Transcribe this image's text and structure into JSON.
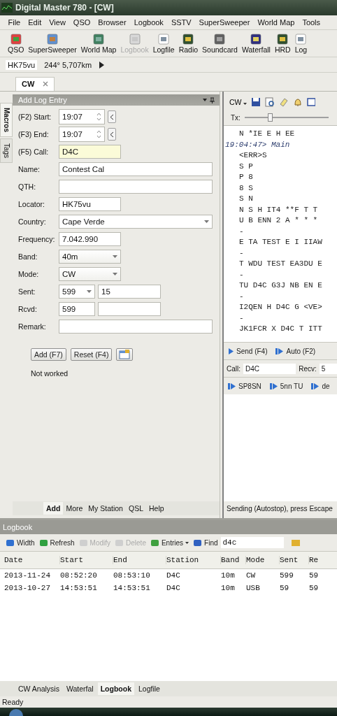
{
  "window": {
    "title": "Digital Master 780 - [CW]"
  },
  "menu": [
    "File",
    "Edit",
    "View",
    "QSO",
    "Browser",
    "Logbook",
    "SSTV",
    "SuperSweeper",
    "World Map",
    "Tools"
  ],
  "toolbar": [
    {
      "label": "QSO",
      "disabled": false
    },
    {
      "label": "SuperSweeper",
      "disabled": false
    },
    {
      "label": "World Map",
      "disabled": false
    },
    {
      "label": "Logbook",
      "disabled": true
    },
    {
      "label": "Logfile",
      "disabled": false
    },
    {
      "label": "Radio",
      "disabled": false
    },
    {
      "label": "Soundcard",
      "disabled": false
    },
    {
      "label": "Waterfall",
      "disabled": false
    },
    {
      "label": "HRD",
      "disabled": false
    },
    {
      "label": "Log",
      "disabled": false
    }
  ],
  "location": {
    "locator": "HK75vu",
    "bearing": "244°  5,707km"
  },
  "document_tabs": [
    {
      "label": "CW",
      "selected": true
    }
  ],
  "side_tabs": [
    {
      "label": "Macros",
      "selected": true
    },
    {
      "label": "Tags",
      "selected": false
    }
  ],
  "add_log_entry": {
    "title": "Add Log Entry",
    "fields": [
      {
        "label": "(F2)  Start:",
        "kind": "time",
        "value": "19:07"
      },
      {
        "label": "(F3)  End:",
        "kind": "time",
        "value": "19:07"
      },
      {
        "label": "(F5)  Call:",
        "kind": "text",
        "wide": false,
        "value": "D4C",
        "highlighted": true
      },
      {
        "label": "Name:",
        "kind": "text",
        "wide": true,
        "value": "Contest Cal",
        "highlighted": false
      },
      {
        "label": "QTH:",
        "kind": "text",
        "wide": true,
        "highlighted": false
      },
      {
        "label": "Locator:",
        "kind": "text",
        "wide": false,
        "value": "HK75vu",
        "highlighted": false
      },
      {
        "label": "Country:",
        "kind": "combo",
        "wide": true,
        "value": "Cape Verde"
      },
      {
        "label": "Frequency:",
        "kind": "text",
        "wide": false,
        "value": "7.042.990",
        "highlighted": false
      },
      {
        "label": "Band:",
        "kind": "combo",
        "wide": false,
        "value": "40m"
      },
      {
        "label": "Mode:",
        "kind": "combo",
        "wide": false,
        "value": "CW"
      },
      {
        "label": "Sent:",
        "kind": "pair",
        "value": "599",
        "dropdown": true,
        "value2": "15"
      },
      {
        "label": "Rcvd:",
        "kind": "pair",
        "value": "599",
        "dropdown": false
      },
      {
        "label": "Remark:",
        "kind": "text",
        "wide": true,
        "highlighted": false
      }
    ],
    "buttons": [
      "Add (F7)",
      "Reset (F4)"
    ],
    "status": "Not worked",
    "tabs": [
      {
        "label": "Add",
        "selected": true
      },
      {
        "label": "More",
        "selected": false
      },
      {
        "label": "My Station",
        "selected": false
      },
      {
        "label": "QSL",
        "selected": false
      },
      {
        "label": "Help",
        "selected": false
      }
    ]
  },
  "cw_panel": {
    "mode": "CW",
    "tx": {
      "label": "Tx:",
      "level": 0.3
    },
    "lines": [
      {
        "text": "N *IE E H EE",
        "kind": "received"
      },
      {
        "text": "19:04:47> Main",
        "kind": "timestamp"
      },
      {
        "text": "<ERR>S",
        "kind": "received"
      },
      {
        "text": "S P",
        "kind": "received"
      },
      {
        "text": "P 8",
        "kind": "received"
      },
      {
        "text": "8 S",
        "kind": "received"
      },
      {
        "text": "S N",
        "kind": "received"
      },
      {
        "text": "N S H IT4 **F T T",
        "kind": "received"
      },
      {
        "text": "U B ENN 2 A * * *",
        "kind": "received"
      },
      {
        "text": "-",
        "kind": "received"
      },
      {
        "text": "E TA TEST E I IIAW",
        "kind": "received"
      },
      {
        "text": "-",
        "kind": "received"
      },
      {
        "text": "T WDU TEST EA3DU E",
        "kind": "received"
      },
      {
        "text": "-",
        "kind": "received"
      },
      {
        "text": "TU D4C G3J NB EN E",
        "kind": "received"
      },
      {
        "text": "-",
        "kind": "received"
      },
      {
        "text": "I2QEN H D4C G <VE>",
        "kind": "received"
      },
      {
        "text": "-",
        "kind": "received"
      },
      {
        "text": "JK1FCR X D4C T ITT",
        "kind": "received"
      }
    ],
    "buttons": [
      "Send (F4)",
      "Auto (F2)"
    ],
    "call_label": "Call:",
    "call": "D4C",
    "recv_label": "Recv:",
    "recv": "5",
    "macros": [
      "SP8SN",
      "5nn TU",
      "de"
    ],
    "status": "Sending (Autostop), press Escape"
  },
  "logbook": {
    "title": "Logbook",
    "toolbar": [
      {
        "label": "Width",
        "disabled": false,
        "dropdown": false
      },
      {
        "label": "Refresh",
        "disabled": false,
        "dropdown": false
      },
      {
        "label": "Modify",
        "disabled": true,
        "dropdown": false
      },
      {
        "label": "Delete",
        "disabled": true,
        "dropdown": false
      },
      {
        "label": "Entries",
        "disabled": false,
        "dropdown": true
      },
      {
        "label": "Find",
        "disabled": false,
        "dropdown": false
      }
    ],
    "find_value": "d4c",
    "columns": [
      "Date",
      "Start",
      "End",
      "Station",
      "Band",
      "Mode",
      "Sent",
      "Re"
    ],
    "rows": [
      [
        "2013-11-24",
        "08:52:20",
        "08:53:10",
        "D4C",
        "10m",
        "CW",
        "599",
        "59"
      ],
      [
        "2013-10-27",
        "14:53:51",
        "14:53:51",
        "D4C",
        "10m",
        "USB",
        "59",
        "59"
      ]
    ]
  },
  "bottom_tabs": [
    {
      "label": "CW Analysis",
      "selected": false
    },
    {
      "label": "Waterfal",
      "selected": false
    },
    {
      "label": "Logbook",
      "selected": true
    },
    {
      "label": "Logfile",
      "selected": false
    }
  ],
  "status_bar": "Ready"
}
